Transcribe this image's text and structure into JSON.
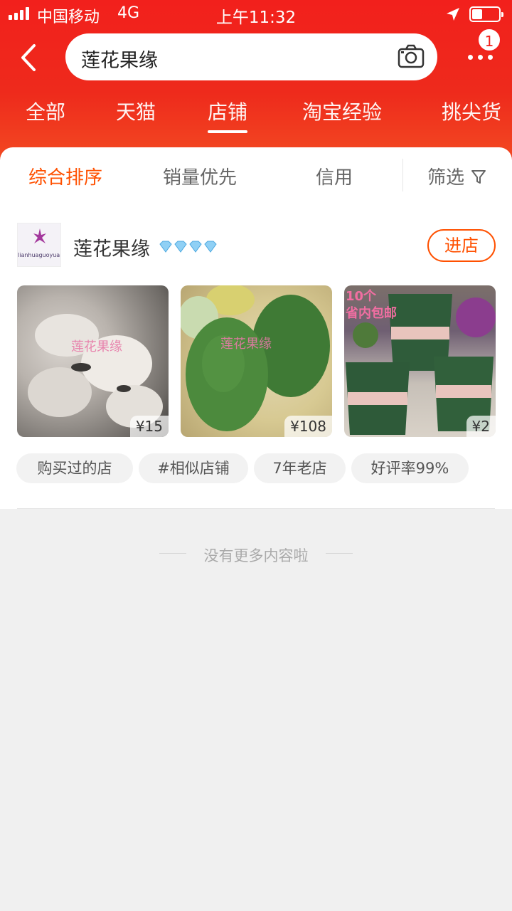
{
  "status_bar": {
    "carrier": "中国移动",
    "network": "4G",
    "time": "上午11:32"
  },
  "search": {
    "query": "莲花果缘",
    "badge_count": "1"
  },
  "tabs": [
    {
      "label": "全部",
      "active": false
    },
    {
      "label": "天猫",
      "active": false
    },
    {
      "label": "店铺",
      "active": true
    },
    {
      "label": "淘宝经验",
      "active": false
    },
    {
      "label": "挑尖货",
      "active": false
    }
  ],
  "sort_bar": {
    "items": [
      {
        "label": "综合排序",
        "active": true
      },
      {
        "label": "销量优先",
        "active": false
      },
      {
        "label": "信用",
        "active": false
      }
    ],
    "filter_label": "筛选"
  },
  "shop": {
    "name": "莲花果缘",
    "logo_caption": "lianhuaguoyuan",
    "diamond_count": 4,
    "enter_label": "进店",
    "products": [
      {
        "price": "¥15",
        "watermark": "莲花果缘"
      },
      {
        "price": "¥108",
        "watermark": "莲花果缘"
      },
      {
        "price": "¥2",
        "watermark": "10个\n省内包邮"
      }
    ],
    "tags": [
      "购买过的店",
      "#相似店铺",
      "7年老店",
      "好评率99%"
    ]
  },
  "footer": {
    "no_more": "没有更多内容啦"
  },
  "colors": {
    "brand_red": "#f2201c",
    "accent_orange": "#ff5000"
  }
}
